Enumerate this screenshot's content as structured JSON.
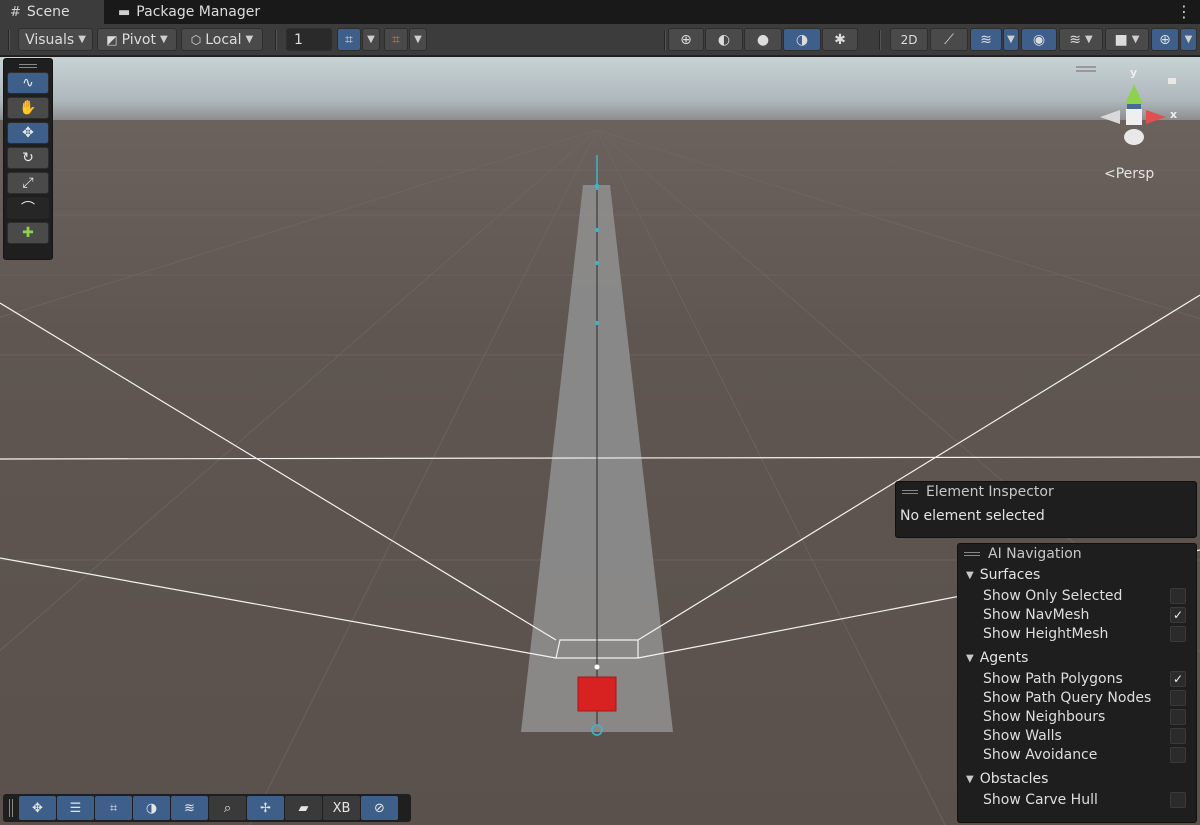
{
  "tabs": [
    {
      "label": "Scene",
      "icon": "grid-hash-icon"
    },
    {
      "label": "Package Manager",
      "icon": "package-icon"
    }
  ],
  "toolbar": {
    "visuals_label": "Visuals",
    "pivot_label": "Pivot",
    "local_label": "Local",
    "grid_size_value": "1"
  },
  "tools": [
    "path-tool-icon",
    "hand-icon",
    "move-icon",
    "rotate-icon",
    "scale-icon",
    "spline-tool-icon",
    "custom-tool-icon"
  ],
  "scene": {
    "persp_label": "Persp",
    "axis_y": "y",
    "axis_x": "x"
  },
  "bottom_tools": {
    "xb_label": "XB"
  },
  "element_inspector": {
    "title": "Element Inspector",
    "status": "No element selected"
  },
  "ai_navigation": {
    "title": "AI Navigation",
    "surfaces": {
      "label": "Surfaces",
      "options": [
        {
          "label": "Show Only Selected",
          "checked": false
        },
        {
          "label": "Show NavMesh",
          "checked": true
        },
        {
          "label": "Show HeightMesh",
          "checked": false
        }
      ]
    },
    "agents": {
      "label": "Agents",
      "options": [
        {
          "label": "Show Path Polygons",
          "checked": true
        },
        {
          "label": "Show Path Query Nodes",
          "checked": false
        },
        {
          "label": "Show Neighbours",
          "checked": false
        },
        {
          "label": "Show Walls",
          "checked": false
        },
        {
          "label": "Show Avoidance",
          "checked": false
        }
      ]
    },
    "obstacles": {
      "label": "Obstacles",
      "options": [
        {
          "label": "Show Carve Hull",
          "checked": false
        }
      ]
    },
    "check_mark": "✓"
  },
  "colors": {
    "accent_blue": "#3e5f8a",
    "ground": "#5e5550",
    "navmesh": "#8c8c8c",
    "agent_red": "#e02020",
    "gizmo_green": "#8fd14f",
    "gizmo_red": "#e05050"
  }
}
